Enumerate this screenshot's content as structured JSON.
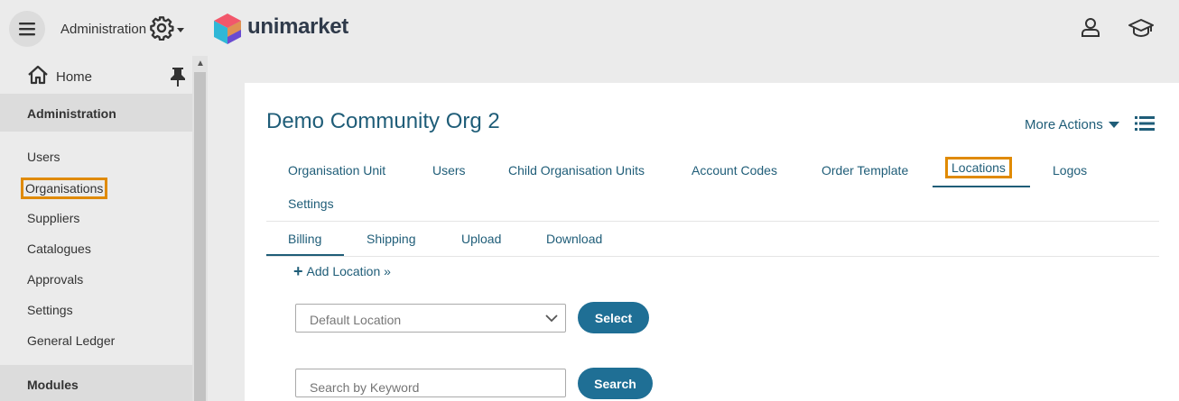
{
  "header": {
    "admin_label": "Administration",
    "brand": "unimarket"
  },
  "sidebar": {
    "home": "Home",
    "section_admin": "Administration",
    "items": [
      {
        "label": "Users"
      },
      {
        "label": "Organisations",
        "active": true
      },
      {
        "label": "Suppliers"
      },
      {
        "label": "Catalogues"
      },
      {
        "label": "Approvals"
      },
      {
        "label": "Settings"
      },
      {
        "label": "General Ledger"
      }
    ],
    "section_modules": "Modules"
  },
  "main": {
    "title": "Demo Community Org 2",
    "more_actions": "More Actions",
    "tabs": [
      {
        "label": "Organisation Unit"
      },
      {
        "label": "Users"
      },
      {
        "label": "Child Organisation Units"
      },
      {
        "label": "Account Codes"
      },
      {
        "label": "Order Template"
      },
      {
        "label": "Locations",
        "active": true
      },
      {
        "label": "Logos"
      },
      {
        "label": "Settings"
      }
    ],
    "subtabs": [
      {
        "label": "Billing",
        "active": true
      },
      {
        "label": "Shipping"
      },
      {
        "label": "Upload"
      },
      {
        "label": "Download"
      }
    ],
    "add_location": "Add Location »",
    "location_select": {
      "value": "Default Location"
    },
    "select_button": "Select",
    "search": {
      "placeholder": "Search by Keyword"
    },
    "search_button": "Search"
  },
  "colors": {
    "accent": "#1f5d78",
    "button": "#1f6f95",
    "highlight": "#e08a00"
  }
}
